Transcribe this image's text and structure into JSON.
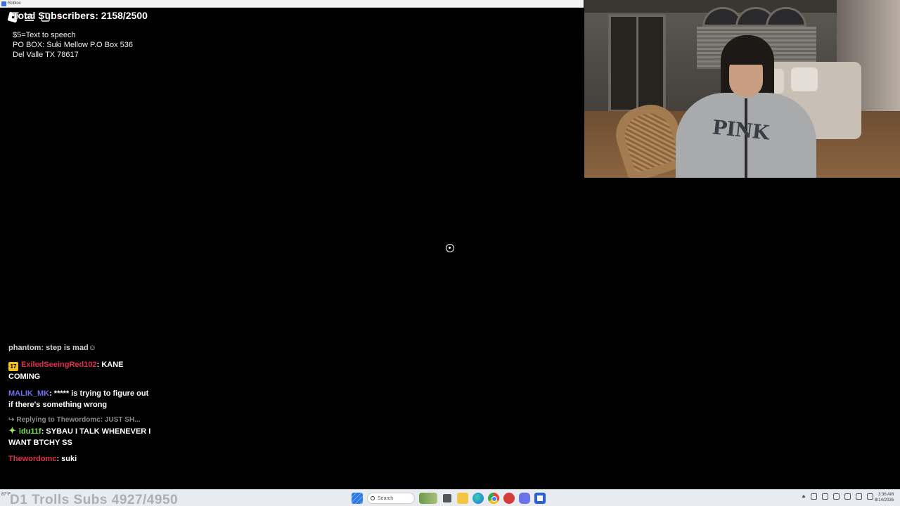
{
  "window": {
    "title": "Roblox"
  },
  "overlay": {
    "subscriber_counter": "Total Subscribers: 2158/2500",
    "info_lines": [
      "$5=Text to speech",
      "PO BOX: Suki Mellow P.O Box 536",
      "Del Valle TX 78617"
    ]
  },
  "roblox_icons": [
    "roblox-logo-icon",
    "menu-icon",
    "chat-icon",
    "heart-icon"
  ],
  "webcam": {
    "hoodie_text": "PINK"
  },
  "chat": {
    "cut_off_message": "phantom: step is mad☺",
    "messages": [
      {
        "badge": "17",
        "user": "ExiledSeeingRed102",
        "text": ": KANE COMING",
        "color": "#e2304e"
      },
      {
        "user": "MALIK_MK",
        "text": ": ***** is trying to figure out if there's something wrong",
        "color": "#6e6ef0"
      },
      {
        "reply_to": "Replying to Thewordomc: JUST SH...",
        "user": "idu11f",
        "text": ": SYBAU I TALK WHENEVER I WANT BTCHY SS",
        "color": "#7fe04c"
      },
      {
        "user": "Thewordomc",
        "text": ": suki",
        "color": "#e0344f"
      }
    ]
  },
  "taskbar": {
    "weather": "87°F",
    "ghost_text": "D1 Trolls Subs 4927/4950",
    "search_label": "Search",
    "time": "3:36 AM",
    "date": "8/14/2026"
  }
}
